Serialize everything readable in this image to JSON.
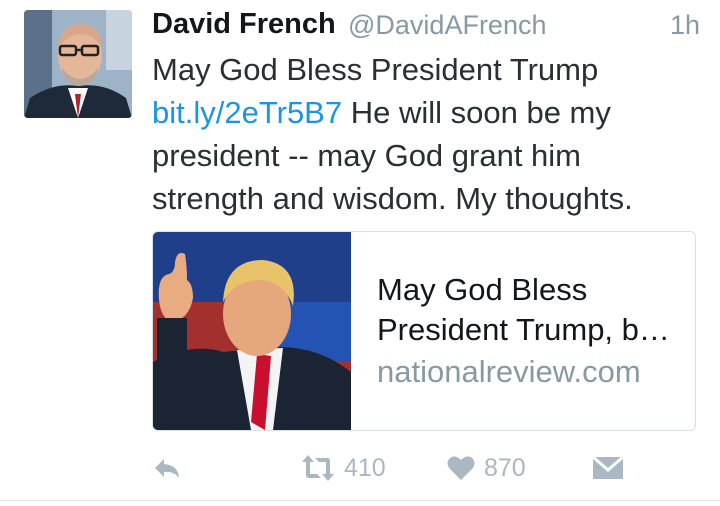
{
  "author": {
    "name": "David French",
    "handle": "@DavidAFrench"
  },
  "timestamp": "1h",
  "text": {
    "line1": "May God Bless President Trump",
    "link": "bit.ly/2eTr5B7",
    "rest": " He will soon be my president -- may God grant him strength and wisdom. My thoughts."
  },
  "card": {
    "title": "May God Bless President Trump, b…",
    "domain": "nationalreview.com"
  },
  "actions": {
    "reply_icon": "reply-icon",
    "retweet_icon": "retweet-icon",
    "retweet_count": "410",
    "like_icon": "heart-icon",
    "like_count": "870",
    "dm_icon": "envelope-icon"
  },
  "colors": {
    "link": "#1b95e0",
    "muted": "#8899a6",
    "icon": "#aab8c2"
  }
}
